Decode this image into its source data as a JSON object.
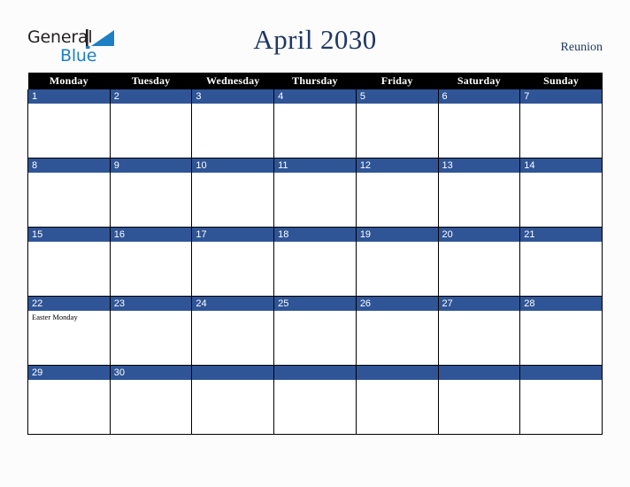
{
  "brand": {
    "line1": "General",
    "line2": "Blue",
    "mark": "triangle-logo-mark"
  },
  "header": {
    "title": "April 2030",
    "region": "Reunion"
  },
  "calendar": {
    "weekday_headers": [
      "Monday",
      "Tuesday",
      "Wednesday",
      "Thursday",
      "Friday",
      "Saturday",
      "Sunday"
    ],
    "accent_color": "#2f5597",
    "header_color": "#000000",
    "title_color": "#1f3864",
    "weeks": [
      [
        {
          "day": "1",
          "events": []
        },
        {
          "day": "2",
          "events": []
        },
        {
          "day": "3",
          "events": []
        },
        {
          "day": "4",
          "events": []
        },
        {
          "day": "5",
          "events": []
        },
        {
          "day": "6",
          "events": []
        },
        {
          "day": "7",
          "events": []
        }
      ],
      [
        {
          "day": "8",
          "events": []
        },
        {
          "day": "9",
          "events": []
        },
        {
          "day": "10",
          "events": []
        },
        {
          "day": "11",
          "events": []
        },
        {
          "day": "12",
          "events": []
        },
        {
          "day": "13",
          "events": []
        },
        {
          "day": "14",
          "events": []
        }
      ],
      [
        {
          "day": "15",
          "events": []
        },
        {
          "day": "16",
          "events": []
        },
        {
          "day": "17",
          "events": []
        },
        {
          "day": "18",
          "events": []
        },
        {
          "day": "19",
          "events": []
        },
        {
          "day": "20",
          "events": []
        },
        {
          "day": "21",
          "events": []
        }
      ],
      [
        {
          "day": "22",
          "events": [
            "Easter Monday"
          ]
        },
        {
          "day": "23",
          "events": []
        },
        {
          "day": "24",
          "events": []
        },
        {
          "day": "25",
          "events": []
        },
        {
          "day": "26",
          "events": []
        },
        {
          "day": "27",
          "events": []
        },
        {
          "day": "28",
          "events": []
        }
      ],
      [
        {
          "day": "29",
          "events": []
        },
        {
          "day": "30",
          "events": []
        },
        {
          "day": "",
          "events": []
        },
        {
          "day": "",
          "events": []
        },
        {
          "day": "",
          "events": []
        },
        {
          "day": "",
          "events": []
        },
        {
          "day": "",
          "events": []
        }
      ]
    ]
  }
}
